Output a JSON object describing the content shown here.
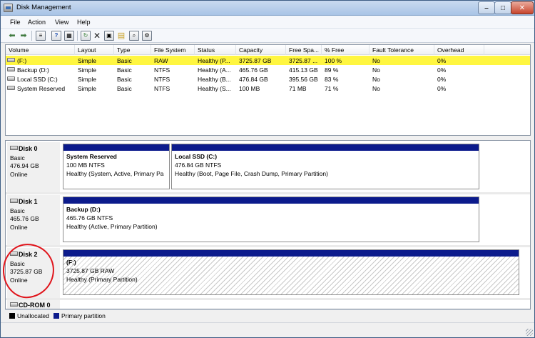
{
  "window": {
    "title": "Disk Management"
  },
  "menu": [
    "File",
    "Action",
    "View",
    "Help"
  ],
  "toolbar": {
    "icons": [
      "back-arrow-icon",
      "forward-arrow-icon",
      "properties-icon",
      "help-icon",
      "refresh-icon",
      "delete-icon",
      "new-icon",
      "open-icon",
      "search-icon",
      "settings-icon"
    ]
  },
  "volume_table": {
    "columns": [
      "Volume",
      "Layout",
      "Type",
      "File System",
      "Status",
      "Capacity",
      "Free Spa...",
      "% Free",
      "Fault Tolerance",
      "Overhead"
    ],
    "rows": [
      [
        "(F:)",
        "Simple",
        "Basic",
        "RAW",
        "Healthy (P...",
        "3725.87 GB",
        "3725.87 ...",
        "100 %",
        "No",
        "0%"
      ],
      [
        "Backup (D:)",
        "Simple",
        "Basic",
        "NTFS",
        "Healthy (A...",
        "465.76 GB",
        "415.13 GB",
        "89 %",
        "No",
        "0%"
      ],
      [
        "Local SSD (C:)",
        "Simple",
        "Basic",
        "NTFS",
        "Healthy (B...",
        "476.84 GB",
        "395.56 GB",
        "83 %",
        "No",
        "0%"
      ],
      [
        "System Reserved",
        "Simple",
        "Basic",
        "NTFS",
        "Healthy (S...",
        "100 MB",
        "71 MB",
        "71 %",
        "No",
        "0%"
      ]
    ]
  },
  "disks": [
    {
      "name": "Disk 0",
      "type": "Basic",
      "size": "476.94 GB",
      "status": "Online",
      "partitions": [
        {
          "name": "System Reserved",
          "size": "100 MB NTFS",
          "status": "Healthy (System, Active, Primary Pa"
        },
        {
          "name": "Local SSD  (C:)",
          "size": "476.84 GB NTFS",
          "status": "Healthy (Boot, Page File, Crash Dump, Primary Partition)"
        }
      ]
    },
    {
      "name": "Disk 1",
      "type": "Basic",
      "size": "465.76 GB",
      "status": "Online",
      "partitions": [
        {
          "name": "Backup  (D:)",
          "size": "465.76 GB NTFS",
          "status": "Healthy (Active, Primary Partition)"
        }
      ]
    },
    {
      "name": "Disk 2",
      "type": "Basic",
      "size": "3725.87 GB",
      "status": "Online",
      "partitions": [
        {
          "name": "(F:)",
          "size": "3725.87 GB RAW",
          "status": "Healthy (Primary Partition)"
        }
      ]
    },
    {
      "name": "CD-ROM 0"
    }
  ],
  "legend": [
    {
      "label": "Unallocated",
      "color": "#000000"
    },
    {
      "label": "Primary partition",
      "color": "#0c1b8c"
    }
  ],
  "colors": {
    "highlight": "#fff640",
    "partition_bar": "#0c1b8c",
    "annotation": "#e0141b"
  }
}
